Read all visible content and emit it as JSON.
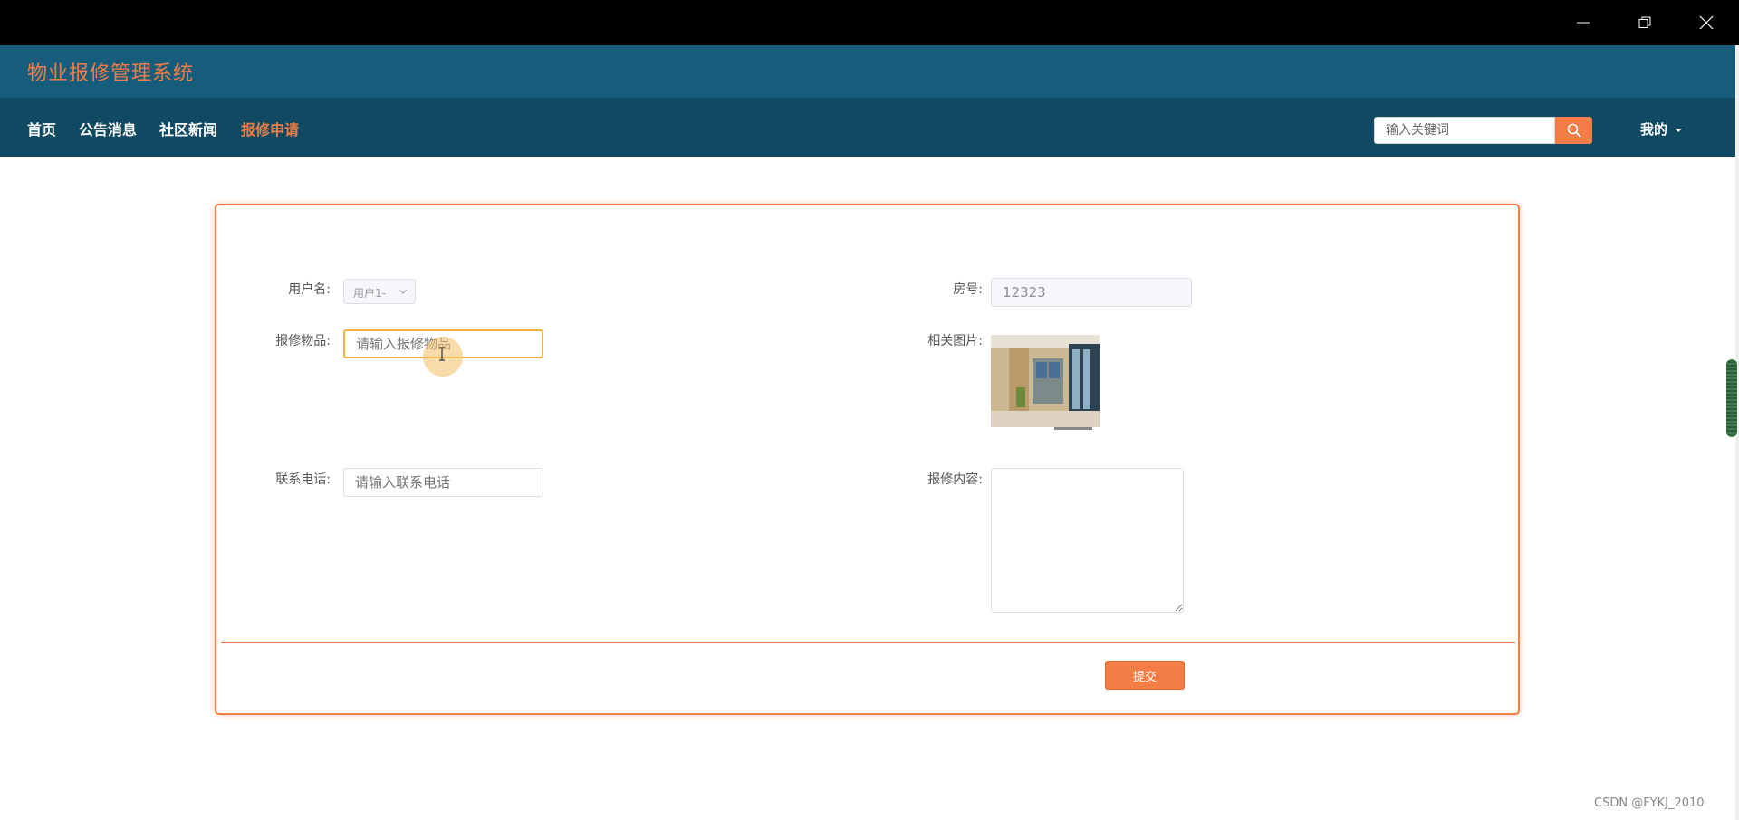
{
  "window": {
    "minimize_icon": "minimize-icon",
    "restore_icon": "restore-icon",
    "close_icon": "close-icon"
  },
  "header": {
    "app_title": "物业报修管理系统"
  },
  "nav": {
    "items": [
      {
        "label": "首页",
        "active": false
      },
      {
        "label": "公告消息",
        "active": false
      },
      {
        "label": "社区新闻",
        "active": false
      },
      {
        "label": "报修申请",
        "active": true
      }
    ],
    "search_placeholder": "输入关键词",
    "search_icon": "search-icon",
    "user_menu_label": "我的"
  },
  "form": {
    "username": {
      "label": "用户名:",
      "value": "用户1-"
    },
    "room": {
      "label": "房号:",
      "value": "12323"
    },
    "item": {
      "label": "报修物品:",
      "placeholder": "请输入报修物品"
    },
    "photo": {
      "label": "相关图片:"
    },
    "phone": {
      "label": "联系电话:",
      "placeholder": "请输入联系电话"
    },
    "content": {
      "label": "报修内容:",
      "value": ""
    },
    "submit_label": "提交"
  },
  "watermark": "CSDN @FYKJ_2010",
  "colors": {
    "accent": "#f27d46",
    "header_bg": "#155d7a",
    "nav_bg": "#104a62",
    "titlebar_bg": "#000000"
  }
}
